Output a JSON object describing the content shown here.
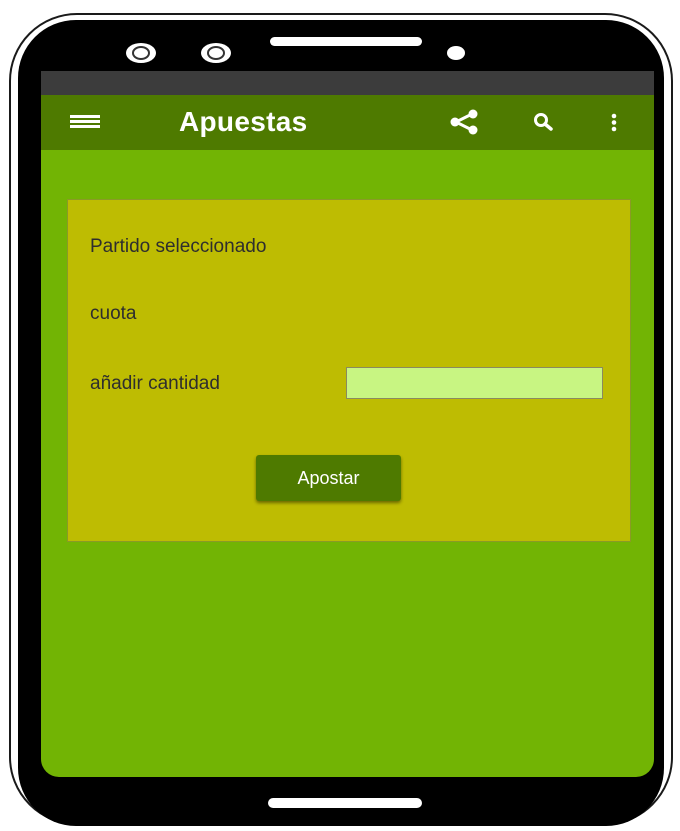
{
  "app": {
    "title": "Apuestas"
  },
  "toolbar": {
    "menu_icon": "hamburger-menu-icon",
    "share_icon": "share-icon",
    "search_icon": "search-icon",
    "overflow_icon": "more-vert-icon"
  },
  "form": {
    "match_label": "Partido seleccionado",
    "odds_label": "cuota",
    "amount_label": "añadir cantidad",
    "amount_value": "",
    "bet_button_label": "Apostar"
  },
  "colors": {
    "screen_background": "#72b404",
    "appbar": "#4e7a00",
    "card_background": "#bebc02",
    "input_background": "#c8f582",
    "button_background": "#4e7a00"
  }
}
